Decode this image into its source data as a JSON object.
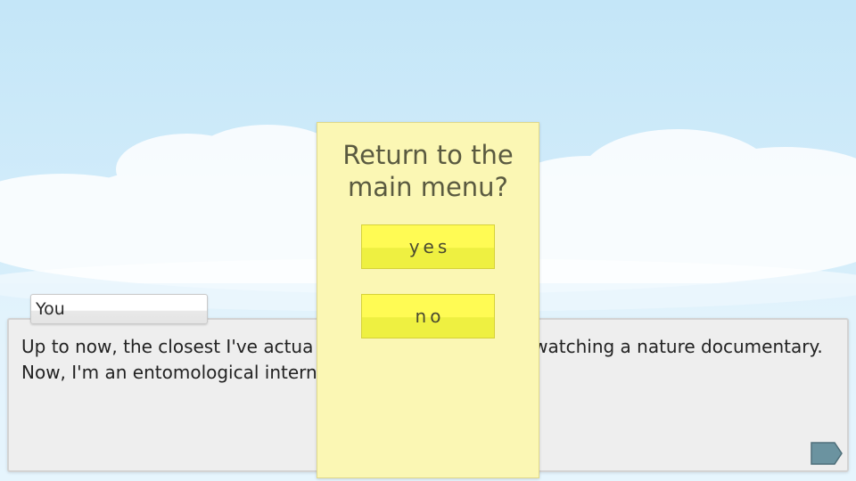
{
  "speaker": {
    "name": "You"
  },
  "dialogue": {
    "text": "Up to now, the closest I've actua                                   her than a cockroach is watching a nature documentary. Now, I'm an entomological intern at the Majniart Museum."
  },
  "modal": {
    "title_line1": "Return to the",
    "title_line2": "main menu?",
    "yes_label": "yes",
    "no_label": "no"
  },
  "icons": {
    "advance": "arrow-right-icon"
  },
  "colors": {
    "sky_top": "#c4e6f8",
    "modal_bg": "#fbf7b4",
    "button_bg": "#fffb54",
    "dialogue_bg": "#eeeeee",
    "advance_button": "#6b93a0"
  }
}
